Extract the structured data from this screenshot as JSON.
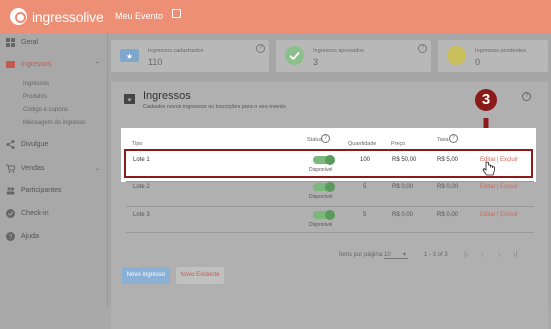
{
  "topbar": {
    "logo_text": "ingressolive",
    "event_title": "Meu Evento"
  },
  "sidebar": {
    "items": [
      {
        "label": "Geral"
      },
      {
        "label": "Ingressos"
      },
      {
        "label": "Divulgue"
      },
      {
        "label": "Vendas"
      },
      {
        "label": "Participantes"
      },
      {
        "label": "Check-in"
      },
      {
        "label": "Ajuda"
      }
    ],
    "sub_items": [
      "Ingressos",
      "Produtos",
      "Código e cupons",
      "Mensagem do ingresso"
    ]
  },
  "stats": [
    {
      "label": "Ingressos cadastrados",
      "value": "110"
    },
    {
      "label": "Ingressos aprovados",
      "value": "3"
    },
    {
      "label": "Ingressos pendentes",
      "value": "0"
    }
  ],
  "panel": {
    "title": "Ingressos",
    "subtitle": "Cadastre novos ingressos ou inscrições para o seu evento",
    "headers": {
      "tipo": "Tipo",
      "status": "Status",
      "quantidade": "Quantidade",
      "preco": "Preço",
      "taxa": "Taxa"
    },
    "rows": [
      {
        "tipo": "Lote 1",
        "status": "Disponível",
        "quantidade": "100",
        "preco": "R$ 50,00",
        "taxa": "R$ 5,00",
        "edit": "Editar",
        "sep": "|",
        "delete": "Excluir"
      },
      {
        "tipo": "Lote 2",
        "status": "Disponível",
        "quantidade": "5",
        "preco": "R$ 0,00",
        "taxa": "R$ 0,00",
        "edit": "Editar",
        "sep": "|",
        "delete": "Excluir"
      },
      {
        "tipo": "Lote 3",
        "status": "Disponível",
        "quantidade": "5",
        "preco": "R$ 0,00",
        "taxa": "R$ 0,00",
        "edit": "Editar",
        "sep": "|",
        "delete": "Excluir"
      }
    ],
    "pager": {
      "label": "Itens por página:",
      "per_page": "10",
      "range": "1 - 3 of 3"
    },
    "buttons": {
      "new_ticket": "Novo Ingresso",
      "new_lot": "Novo Evidente"
    }
  },
  "annotation": {
    "step": "3"
  },
  "colors": {
    "brand": "#ec8f75",
    "highlight": "#8b1a1a",
    "link": "#d3695a"
  }
}
